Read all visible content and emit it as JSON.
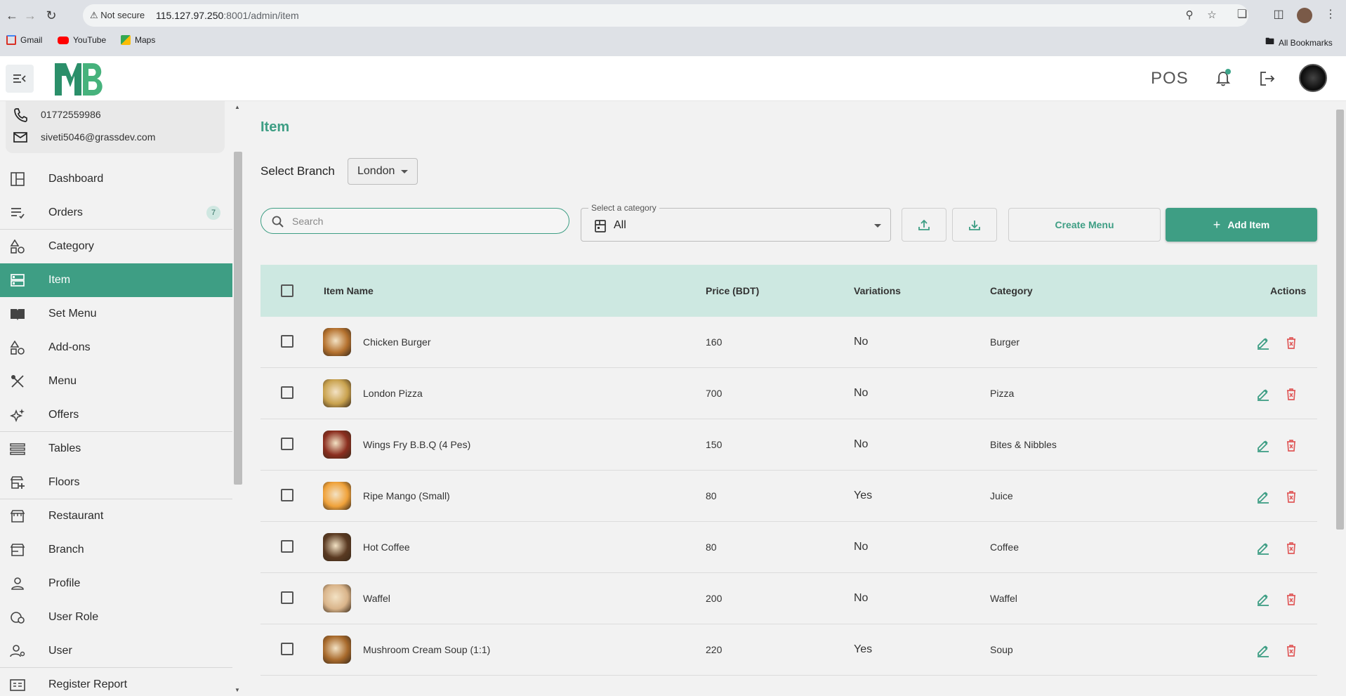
{
  "browser": {
    "security_label": "Not secure",
    "url_host": "115.127.97.250",
    "url_rest": ":8001/admin/item",
    "bookmarks": [
      {
        "label": "Gmail",
        "icon": "gmail-icon",
        "color": "#d93025"
      },
      {
        "label": "YouTube",
        "icon": "youtube-icon",
        "color": "#ff0000"
      },
      {
        "label": "Maps",
        "icon": "maps-icon",
        "color": "#34a853"
      }
    ],
    "all_bookmarks_label": "All Bookmarks"
  },
  "header": {
    "logo_text": "MB",
    "pos_label": "POS",
    "brand_color": "#3e9e84"
  },
  "sidebar": {
    "phone": "01772559986",
    "email": "siveti5046@grassdev.com",
    "items": [
      {
        "label": "Dashboard",
        "icon": "dashboard-icon",
        "badge": null
      },
      {
        "label": "Orders",
        "icon": "orders-icon",
        "badge": "7"
      },
      {
        "label": "Category",
        "icon": "category-icon",
        "badge": null
      },
      {
        "label": "Item",
        "icon": "item-icon",
        "badge": null,
        "active": true
      },
      {
        "label": "Set Menu",
        "icon": "set-menu-icon",
        "badge": null
      },
      {
        "label": "Add-ons",
        "icon": "addons-icon",
        "badge": null
      },
      {
        "label": "Menu",
        "icon": "menu-icon",
        "badge": null
      },
      {
        "label": "Offers",
        "icon": "offers-icon",
        "badge": null
      },
      {
        "label": "Tables",
        "icon": "tables-icon",
        "badge": null
      },
      {
        "label": "Floors",
        "icon": "floors-icon",
        "badge": null
      },
      {
        "label": "Restaurant",
        "icon": "restaurant-icon",
        "badge": null
      },
      {
        "label": "Branch",
        "icon": "branch-icon",
        "badge": null
      },
      {
        "label": "Profile",
        "icon": "profile-icon",
        "badge": null
      },
      {
        "label": "User Role",
        "icon": "user-role-icon",
        "badge": null
      },
      {
        "label": "User",
        "icon": "user-icon",
        "badge": null
      },
      {
        "label": "Register Report",
        "icon": "register-report-icon",
        "badge": null
      }
    ]
  },
  "main": {
    "title": "Item",
    "branch_label": "Select Branch",
    "branch_value": "London",
    "search_placeholder": "Search",
    "category_legend": "Select a category",
    "category_value": "All",
    "create_menu_label": "Create Menu",
    "add_item_label": "Add Item",
    "columns": {
      "name": "Item Name",
      "price": "Price (BDT)",
      "variations": "Variations",
      "category": "Category",
      "actions": "Actions"
    },
    "rows": [
      {
        "name": "Chicken Burger",
        "price": "160",
        "variations": "No",
        "category": "Burger",
        "thumb": "#b5722f"
      },
      {
        "name": "London Pizza",
        "price": "700",
        "variations": "No",
        "category": "Pizza",
        "thumb": "#c9a24e"
      },
      {
        "name": "Wings Fry B.B.Q (4 Pes)",
        "price": "150",
        "variations": "No",
        "category": "Bites & Nibbles",
        "thumb": "#8b2e1f"
      },
      {
        "name": "Ripe Mango (Small)",
        "price": "80",
        "variations": "Yes",
        "category": "Juice",
        "thumb": "#f0a23a"
      },
      {
        "name": "Hot Coffee",
        "price": "80",
        "variations": "No",
        "category": "Coffee",
        "thumb": "#5a3a22"
      },
      {
        "name": "Waffel",
        "price": "200",
        "variations": "No",
        "category": "Waffel",
        "thumb": "#d9b48a"
      },
      {
        "name": "Mushroom Cream Soup (1:1)",
        "price": "220",
        "variations": "Yes",
        "category": "Soup",
        "thumb": "#a86a2c"
      }
    ]
  }
}
